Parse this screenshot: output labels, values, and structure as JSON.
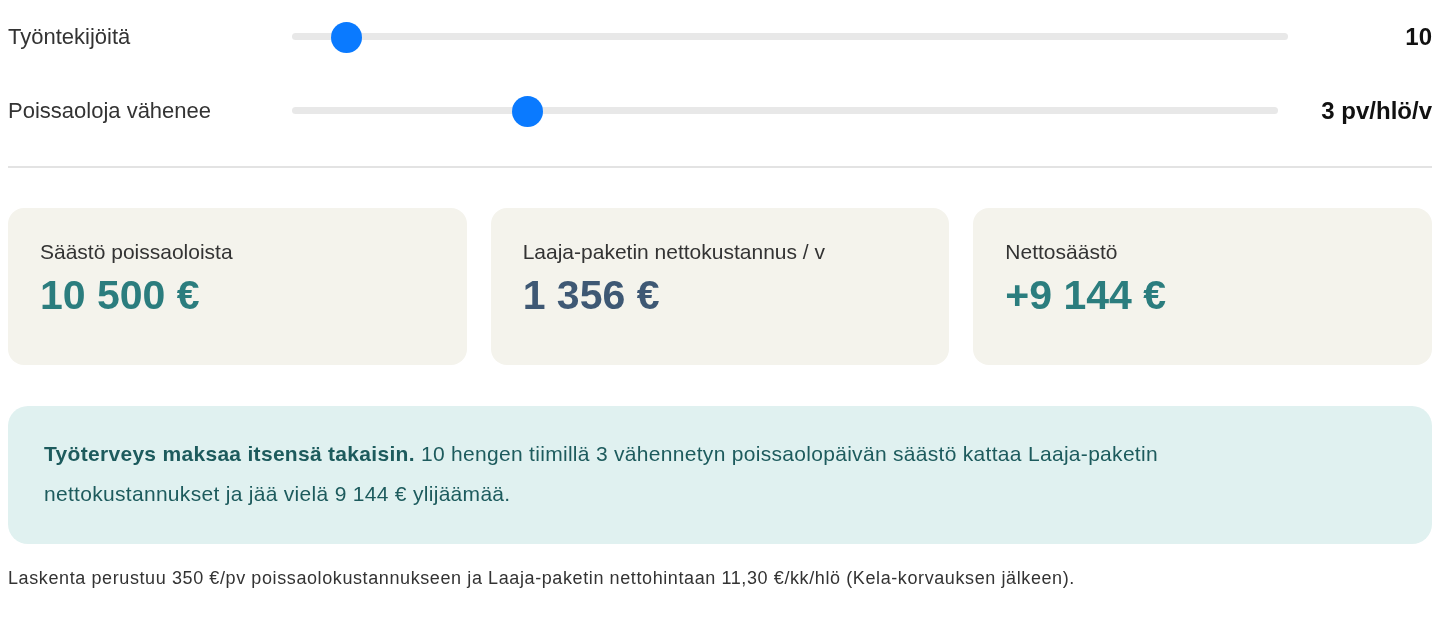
{
  "sliders": [
    {
      "label": "Työntekijöitä",
      "level": 0.04,
      "reading": "10"
    },
    {
      "label": "Poissaoloja vähenee",
      "level": 0.23,
      "reading": "3 pv/hlö/v"
    }
  ],
  "cards": [
    {
      "label": "Säästö poissaoloista",
      "value": "10 500 €",
      "color": "#2b7d7e"
    },
    {
      "label": "Laaja-paketin nettokustannus / v",
      "value": "1 356 €",
      "color": "#3e5874"
    },
    {
      "label": "Nettosäästö",
      "value": "+9 144 €",
      "color": "#2b7d7e"
    }
  ],
  "callout": "**Työterveys maksaa itsensä takaisin.** 10 hengen tiimillä 3 vähennetyn poissaolopäivän säästö kattaa Laaja-paketin nettokustannukset ja jää vielä 9 144 € ylijäämää.",
  "footnote": "Laskenta perustuu 350 €/pv poissaolokustannukseen ja Laaja-paketin nettohintaan 11,30 €/kk/hlö (Kela-korvauksen jälkeen)."
}
